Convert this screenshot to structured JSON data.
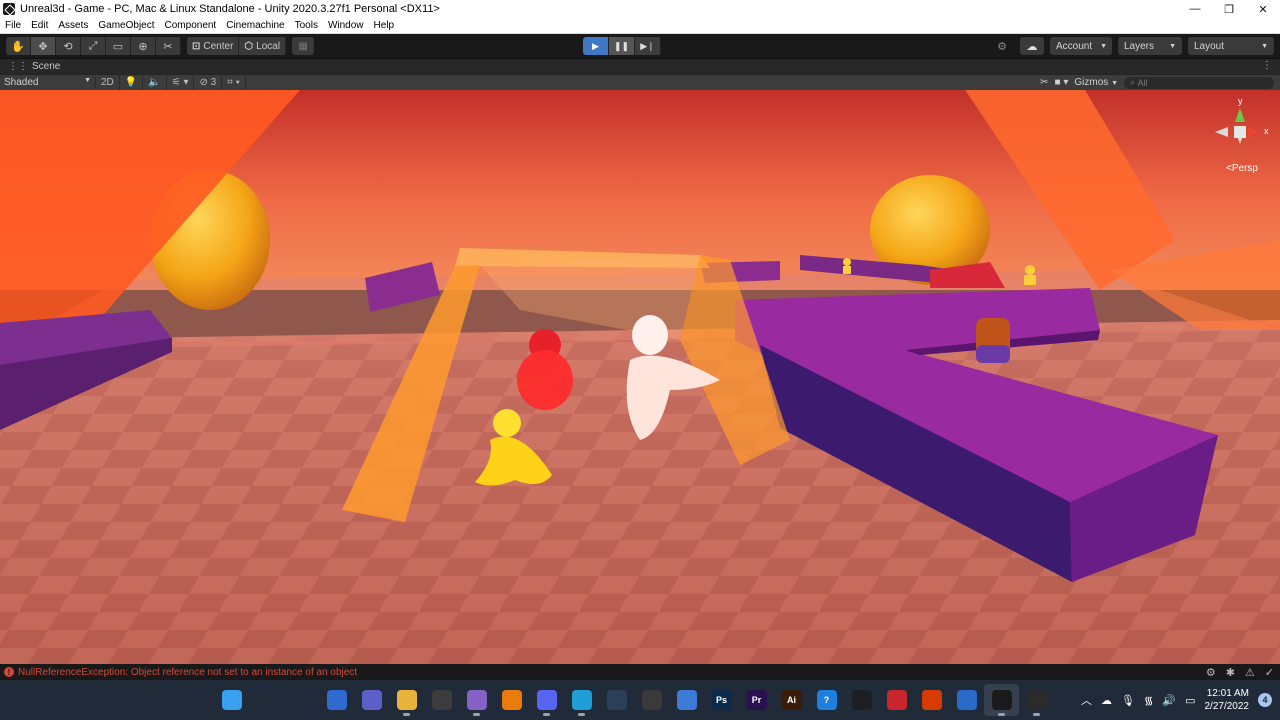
{
  "window": {
    "title": "Unreal3d - Game - PC, Mac & Linux Standalone - Unity 2020.3.27f1 Personal <DX11>",
    "controls": [
      "—",
      "❐",
      "✕"
    ]
  },
  "menu": [
    "File",
    "Edit",
    "Assets",
    "GameObject",
    "Component",
    "Cinemachine",
    "Tools",
    "Window",
    "Help"
  ],
  "toolbar": {
    "tools": [
      "✋",
      "✥",
      "⟲",
      "⤢",
      "▭",
      "⊕",
      "✂"
    ],
    "pivot_mode": "Center",
    "pivot_rotation": "Local",
    "account": "Account",
    "layers": "Layers",
    "layout": "Layout"
  },
  "scene_tab": {
    "label": "Scene"
  },
  "scene_toolbar": {
    "draw_mode": "Shaded",
    "mode_2d": "2D",
    "hidden_count": "3",
    "gizmos": "Gizmos",
    "search_placeholder": "All"
  },
  "gizmo": {
    "y": "y",
    "x": "x",
    "projection": "Persp"
  },
  "status": {
    "message": "NullReferenceException: Object reference not set to an instance of an object"
  },
  "taskbar": {
    "apps": [
      {
        "name": "windows-start-icon",
        "label": "",
        "color": "#3aa0f0"
      },
      {
        "name": "search-icon",
        "label": "",
        "color": "#202a38"
      },
      {
        "name": "task-view-icon",
        "label": "",
        "color": "#202a38"
      },
      {
        "name": "widgets-icon",
        "label": "",
        "color": "#2f6ad0"
      },
      {
        "name": "teams-chat-icon",
        "label": "",
        "color": "#5b5fc7"
      },
      {
        "name": "file-explorer-icon",
        "label": "",
        "color": "#e8b33a"
      },
      {
        "name": "unity-hub-icon",
        "label": "",
        "color": "#3c3c3c"
      },
      {
        "name": "visual-studio-icon",
        "label": "",
        "color": "#8661c5"
      },
      {
        "name": "blender-icon",
        "label": "",
        "color": "#e87d0d"
      },
      {
        "name": "discord-icon",
        "label": "",
        "color": "#5865f2"
      },
      {
        "name": "edge-icon",
        "label": "",
        "color": "#1f9fd6"
      },
      {
        "name": "steam-icon",
        "label": "",
        "color": "#2a3f5a"
      },
      {
        "name": "xbox-icon",
        "label": "",
        "color": "#3a3a3a"
      },
      {
        "name": "store-icon",
        "label": "",
        "color": "#3d7bd6"
      },
      {
        "name": "photoshop-icon",
        "label": "Ps",
        "color": "#0c2a4a"
      },
      {
        "name": "premiere-icon",
        "label": "Pr",
        "color": "#2a1050"
      },
      {
        "name": "illustrator-icon",
        "label": "Ai",
        "color": "#3b1c08"
      },
      {
        "name": "help-icon",
        "label": "?",
        "color": "#1d7fe0"
      },
      {
        "name": "github-icon",
        "label": "",
        "color": "#1b1f23"
      },
      {
        "name": "antivirus-icon",
        "label": "",
        "color": "#c8262c"
      },
      {
        "name": "office-icon",
        "label": "",
        "color": "#d83b01"
      },
      {
        "name": "calendar-icon",
        "label": "",
        "color": "#2a6ac8"
      },
      {
        "name": "unity-editor-icon",
        "label": "",
        "color": "#1a1a1a"
      },
      {
        "name": "obs-icon",
        "label": "",
        "color": "#2b2b2b"
      }
    ],
    "time": "12:01 AM",
    "date": "2/27/2022",
    "notifications": "4"
  },
  "colors": {
    "play_active": "#3f78c4",
    "error": "#d24a3e",
    "sky": "#e8503a",
    "floor": "#c86a58",
    "purple_wall": "#7a1f8c",
    "orange_arch": "#f59a2e"
  }
}
